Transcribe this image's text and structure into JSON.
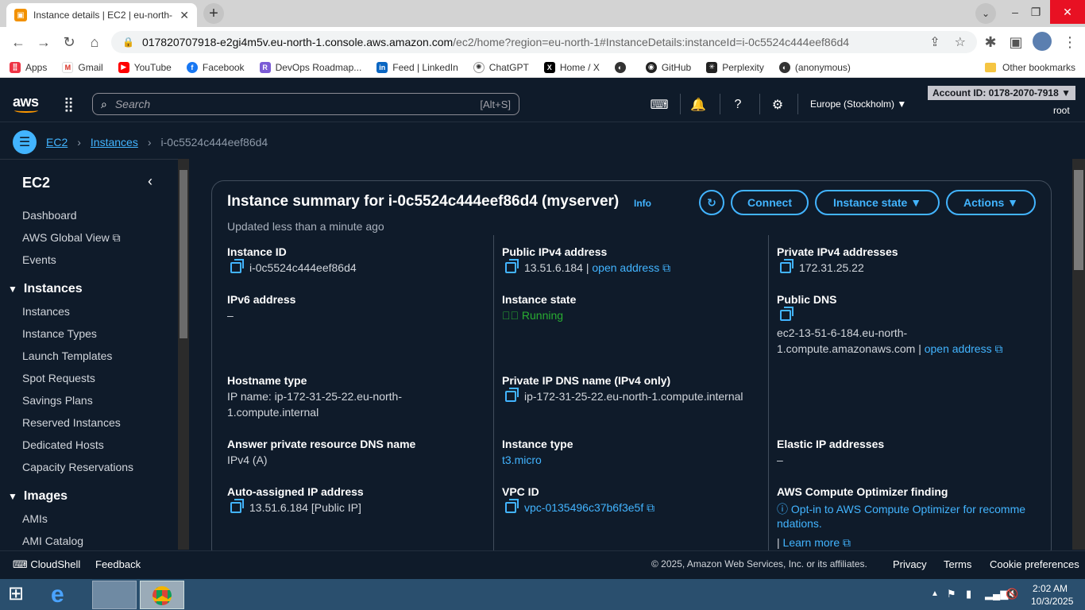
{
  "browser": {
    "tab_title": "Instance details | EC2 | eu-north-",
    "url_host": "017820707918-e2gi4m5v.eu-north-1.console.aws.amazon.com",
    "url_path": "/ec2/home?region=eu-north-1#InstanceDetails:instanceId=i-0c5524c444eef86d4",
    "bookmarks": [
      "Apps",
      "Gmail",
      "YouTube",
      "Facebook",
      "DevOps Roadmap...",
      "Feed | LinkedIn",
      "ChatGPT",
      "Home / X",
      "",
      "GitHub",
      "Perplexity",
      "(anonymous)"
    ],
    "other_bookmarks": "Other bookmarks"
  },
  "aws": {
    "logo": "aws",
    "search_placeholder": "Search",
    "search_shortcut": "[Alt+S]",
    "region": "Europe (Stockholm) ▼",
    "account": "Account ID: 0178-2070-7918 ▼",
    "user": "root"
  },
  "breadcrumb": {
    "ec2": "EC2",
    "instances": "Instances",
    "current": "i-0c5524c444eef86d4"
  },
  "sidebar": {
    "title": "EC2",
    "items_top": [
      "Dashboard",
      "AWS Global View",
      "Events"
    ],
    "sec_instances": "Instances",
    "instances": [
      "Instances",
      "Instance Types",
      "Launch Templates",
      "Spot Requests",
      "Savings Plans",
      "Reserved Instances",
      "Dedicated Hosts",
      "Capacity Reservations"
    ],
    "sec_images": "Images",
    "images": [
      "AMIs",
      "AMI Catalog"
    ]
  },
  "summary": {
    "title": "Instance summary for i-0c5524c444eef86d4 (myserver)",
    "info": "Info",
    "updated": "Updated less than a minute ago",
    "connect": "Connect",
    "instance_state_btn": "Instance state ▼",
    "actions_btn": "Actions ▼",
    "fields": {
      "instance_id_label": "Instance ID",
      "instance_id": "i-0c5524c444eef86d4",
      "public_ipv4_label": "Public IPv4 address",
      "public_ipv4": "13.51.6.184 |",
      "open_address": "open address",
      "private_ipv4_label": "Private IPv4 addresses",
      "private_ipv4": "172.31.25.22",
      "ipv6_label": "IPv6 address",
      "ipv6": "–",
      "instance_state_label": "Instance state",
      "instance_state": "Running",
      "public_dns_label": "Public DNS",
      "public_dns_1": "ec2-13-51-6-184.eu-north-",
      "public_dns_2": "1.compute.amazonaws.com |",
      "hostname_type_label": "Hostname type",
      "hostname_1": "IP name: ip-172-31-25-22.eu-north-",
      "hostname_2": "1.compute.internal",
      "private_dns_label": "Private IP DNS name (IPv4 only)",
      "private_dns": "ip-172-31-25-22.eu-north-1.compute.internal",
      "answer_dns_label": "Answer private resource DNS name",
      "answer_dns": "IPv4 (A)",
      "instance_type_label": "Instance type",
      "instance_type": "t3.micro",
      "elastic_ip_label": "Elastic IP addresses",
      "elastic_ip": "–",
      "auto_ip_label": "Auto-assigned IP address",
      "auto_ip": "13.51.6.184 [Public IP]",
      "vpc_label": "VPC ID",
      "vpc": "vpc-0135496c37b6f3e5f",
      "optimizer_label": "AWS Compute Optimizer finding",
      "optimizer_1": "Opt-in to AWS Compute Optimizer for recomme",
      "optimizer_2": "ndations.",
      "learn_more": "Learn more"
    }
  },
  "footer": {
    "cloudshell": "CloudShell",
    "feedback": "Feedback",
    "copyright": "© 2025, Amazon Web Services, Inc. or its affiliates.",
    "privacy": "Privacy",
    "terms": "Terms",
    "cookies": "Cookie preferences"
  },
  "taskbar": {
    "time": "2:02 AM",
    "date": "10/3/2025"
  }
}
